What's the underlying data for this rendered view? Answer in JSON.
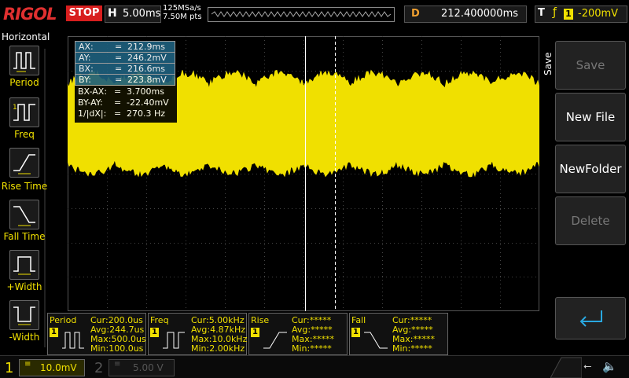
{
  "header": {
    "logo": "RIGOL",
    "run_state": "STOP",
    "timebase_label": "H",
    "timebase_value": "5.00ms",
    "sample_rate": "125MSa/s",
    "memory_depth": "7.50M pts",
    "delay_label": "D",
    "delay_value": "212.400000ms",
    "trigger_label": "T",
    "trigger_source": "1",
    "trigger_level": "-200mV"
  },
  "left_panel": {
    "title": "Horizontal",
    "items": [
      {
        "label": "Period",
        "icon": "period-icon"
      },
      {
        "label": "Freq",
        "icon": "freq-icon"
      },
      {
        "label": "Rise Time",
        "icon": "rise-time-icon"
      },
      {
        "label": "Fall Time",
        "icon": "fall-time-icon"
      },
      {
        "label": "+Width",
        "icon": "positive-width-icon"
      },
      {
        "label": "-Width",
        "icon": "negative-width-icon"
      }
    ]
  },
  "cursor_readout": {
    "rows": [
      {
        "k": "AX:",
        "v": "212.9ms",
        "highlight": true
      },
      {
        "k": "AY:",
        "v": "246.2mV",
        "highlight": true
      },
      {
        "k": "BX:",
        "v": "216.6ms",
        "highlight": true
      },
      {
        "k": "BY:",
        "v": "223.8mV",
        "highlight": true
      },
      {
        "k": "BX-AX:",
        "v": "3.700ms",
        "highlight": false
      },
      {
        "k": "BY-AY:",
        "v": "-22.40mV",
        "highlight": false
      },
      {
        "k": "1/|dX|:",
        "v": "270.3 Hz",
        "highlight": false
      }
    ],
    "eq": "="
  },
  "right_panel": {
    "title": "Save",
    "buttons": [
      {
        "label": "Save",
        "enabled": false
      },
      {
        "label": "New File",
        "enabled": true
      },
      {
        "label": "NewFolder",
        "enabled": true
      },
      {
        "label": "Delete",
        "enabled": false
      }
    ],
    "enter_icon": "enter-icon"
  },
  "measurements": [
    {
      "title": "Period",
      "channel": "1",
      "lines": [
        "Cur:200.0us",
        "Avg:244.7us",
        "Max:500.0us",
        "Min:100.0us"
      ]
    },
    {
      "title": "Freq",
      "channel": "1",
      "lines": [
        "Cur:5.00kHz",
        "Avg:4.87kHz",
        "Max:10.0kHz",
        "Min:2.00kHz"
      ]
    },
    {
      "title": "Rise",
      "channel": "1",
      "lines": [
        "Cur:*****",
        "Avg:*****",
        "Max:*****",
        "Min:*****"
      ]
    },
    {
      "title": "Fall",
      "channel": "1",
      "lines": [
        "Cur:*****",
        "Avg:*****",
        "Max:*****",
        "Min:*****"
      ]
    }
  ],
  "channels": [
    {
      "num": "1",
      "scale": "10.0mV",
      "active": true
    },
    {
      "num": "2",
      "scale": "5.00 V",
      "active": false
    }
  ],
  "colors": {
    "ch1": "#f0e000",
    "stop": "#d81e1e",
    "cursor_highlight": "#1e5f7c"
  }
}
